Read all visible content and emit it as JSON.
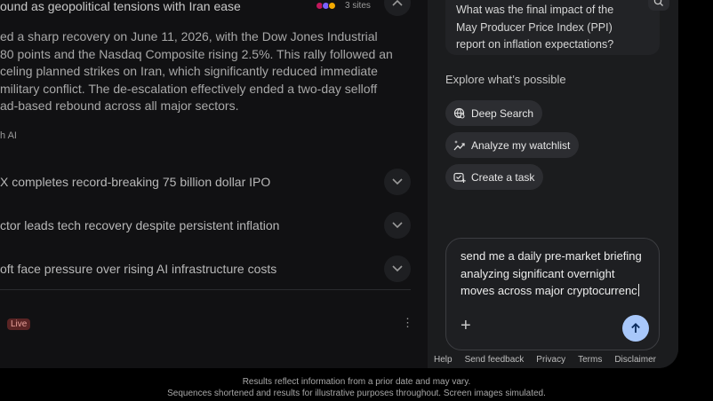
{
  "news": {
    "headline": "ound as geopolitical tensions with Iran ease",
    "sites_label": "3 sites",
    "summary_lines": [
      "ed a sharp recovery on June 11, 2026, with the Dow Jones Industrial",
      "80 points and the Nasdaq Composite rising 2.5%. This rally followed an",
      "celing planned strikes on Iran, which significantly reduced immediate",
      "military conflict. The de-escalation effectively ended a two-day selloff",
      "ad-based rebound across all major sectors."
    ],
    "ai_label": "h AI",
    "stories": [
      "X completes record-breaking 75 billion dollar IPO",
      "ctor leads tech recovery despite persistent inflation",
      "oft face pressure over rising AI infrastructure costs"
    ],
    "live_badge": "Live"
  },
  "panel": {
    "previous_prompt": "What was the final impact of the May Producer Price Index (PPI) report on inflation expectations?",
    "explore_heading": "Explore what’s possible",
    "chips": [
      "Deep Search",
      "Analyze my watchlist",
      "Create a task"
    ],
    "composer_text": "send me a daily pre-market briefing analyzing significant overnight moves across major cryptocurrenc",
    "footer_links": [
      "Help",
      "Send feedback",
      "Privacy",
      "Terms",
      "Disclaimer"
    ]
  },
  "disclaimer": {
    "line1": "Results reflect information from a prior date and may vary.",
    "line2": "Sequences shortened and results for illustrative purposes throughout. Screen images simulated."
  },
  "colors": {
    "accent_send": "#a8c7fa",
    "live_badge_bg": "#5a2424",
    "panel_bg": "#1b1c1e",
    "left_bg": "#111113"
  }
}
